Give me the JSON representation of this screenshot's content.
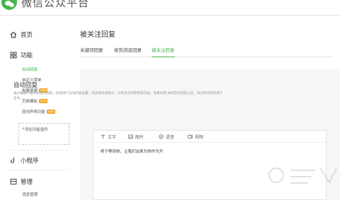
{
  "header": {
    "app_title": "微信公众平台"
  },
  "sidebar": {
    "home": "首页",
    "features": {
      "label": "功能",
      "items": [
        {
          "label": "自动回复",
          "active": true,
          "badge": ""
        },
        {
          "label": "自定义菜单",
          "active": false,
          "badge": ""
        },
        {
          "label": "投票管理",
          "active": false,
          "badge": "NEW"
        },
        {
          "label": "页面模板",
          "active": false,
          "badge": "NEW"
        },
        {
          "label": "原创声明功能",
          "active": false,
          "badge": "NEW"
        }
      ],
      "add_plugin": "添加功能插件"
    },
    "mini_program": "小程序",
    "management": {
      "label": "管理",
      "items": [
        "消息管理"
      ]
    }
  },
  "main": {
    "title": "被关注回复",
    "tabs": [
      {
        "label": "关键词回复",
        "active": false
      },
      {
        "label": "收到消息回复",
        "active": false
      },
      {
        "label": "被关注回复",
        "active": true
      }
    ]
  },
  "panel": {
    "title": "自动回复",
    "description": "通过编辑内容或关键词规则，快速进行自动回复设置。如具备开发能力，可更灵活地使用该功能。查看详情 关闭自动回复之后，将立即对所有用户生效。"
  },
  "editor": {
    "toolbar": [
      {
        "icon": "text-icon",
        "label": "文字"
      },
      {
        "icon": "image-icon",
        "label": "图片"
      },
      {
        "icon": "voice-icon",
        "label": "语音"
      },
      {
        "icon": "video-icon",
        "label": "视频"
      }
    ],
    "content": "终于等到你，让我们出来为你作为开"
  },
  "colors": {
    "accent": "#44b549",
    "badge": "#f5a623"
  }
}
